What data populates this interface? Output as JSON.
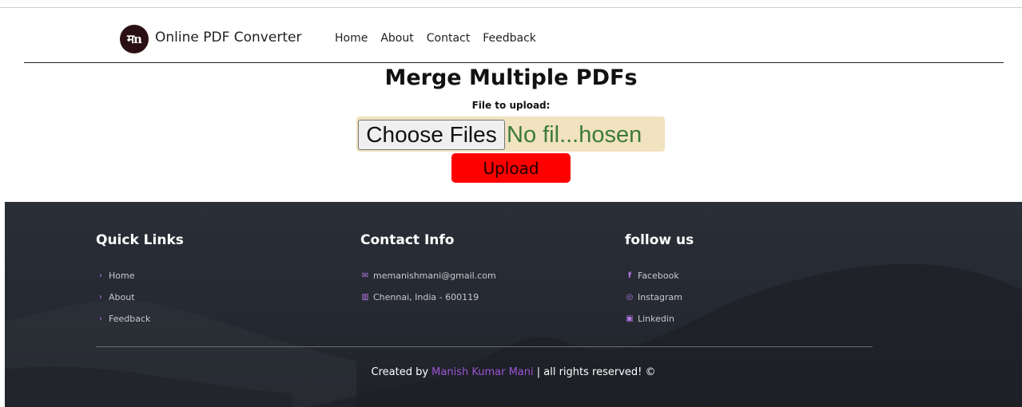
{
  "header": {
    "logo_text": "मn",
    "brand": "Online PDF Converter",
    "nav": [
      "Home",
      "About",
      "Contact",
      "Feedback"
    ]
  },
  "main": {
    "title": "Merge Multiple PDFs",
    "upload_label": "File to upload:",
    "choose_button": "Choose Files",
    "file_status": "No fil...hosen",
    "upload_button": "Upload"
  },
  "footer": {
    "quick_links": {
      "title": "Quick Links",
      "items": [
        "Home",
        "About",
        "Feedback"
      ]
    },
    "contact": {
      "title": "Contact Info",
      "email": "memanishmani@gmail.com",
      "address": "Chennai, India - 600119"
    },
    "follow": {
      "title": "follow us",
      "items": [
        "Facebook",
        "Instagram",
        "Linkedin"
      ]
    },
    "credit_prefix": "Created by ",
    "credit_author": "Manish Kumar Mani",
    "credit_suffix": " | all rights reserved! ©"
  },
  "colors": {
    "accent": "#9b54d4",
    "upload": "#ff0000",
    "file_box": "#f1e2c0",
    "footer_bg": "#262a32"
  },
  "icons": {
    "chevron": "chevron-right-icon",
    "email": "envelope-icon",
    "address": "map-icon",
    "facebook": "facebook-icon",
    "instagram": "instagram-icon",
    "linkedin": "linkedin-icon"
  }
}
